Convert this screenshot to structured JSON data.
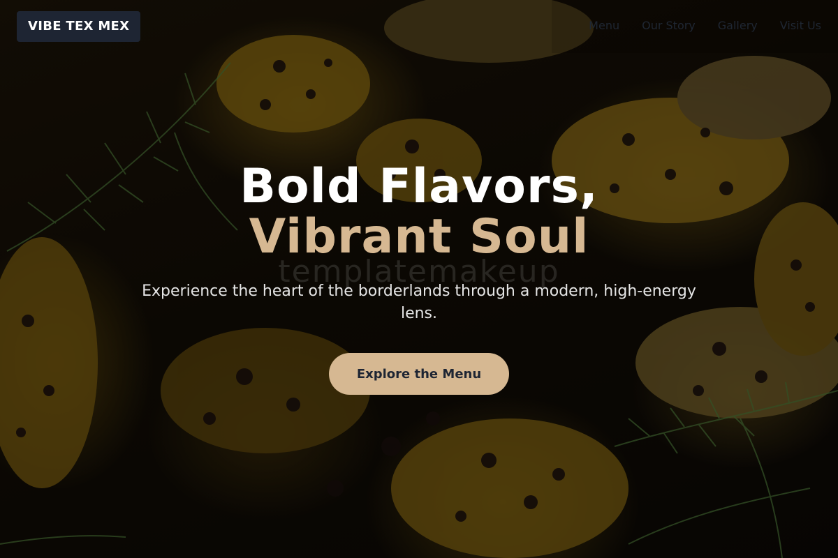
{
  "brand": {
    "name": "VIBE TEX MEX"
  },
  "nav": {
    "items": [
      {
        "label": "Menu"
      },
      {
        "label": "Our Story"
      },
      {
        "label": "Gallery"
      },
      {
        "label": "Visit Us"
      }
    ]
  },
  "hero": {
    "headline_line1": "Bold Flavors,",
    "headline_line2": "Vibrant Soul",
    "watermark": "templatemakeup",
    "subtitle": "Experience the heart of the borderlands through a modern, high-energy lens.",
    "cta_label": "Explore the Menu"
  },
  "colors": {
    "accent": "#d6b892",
    "logo_bg": "#1e2533",
    "nav_text": "#1f2733",
    "headline_white": "#ffffff",
    "background_dark": "#0d0b07"
  },
  "icons": [
    "dill-herb-decoration"
  ]
}
